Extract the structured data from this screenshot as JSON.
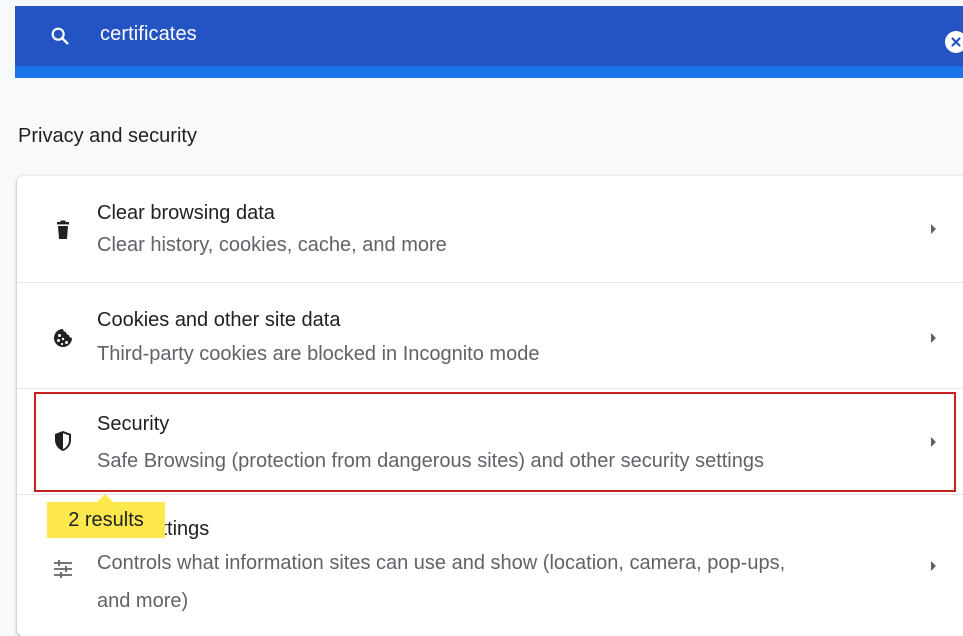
{
  "search": {
    "query": "certificates",
    "icon": "search-icon",
    "clear_icon": "close-icon"
  },
  "section": {
    "title": "Privacy and security"
  },
  "rows": [
    {
      "icon": "trash-icon",
      "title": "Clear browsing data",
      "subtitle": "Clear history, cookies, cache, and more"
    },
    {
      "icon": "cookie-icon",
      "title": "Cookies and other site data",
      "subtitle": "Third-party cookies are blocked in Incognito mode"
    },
    {
      "icon": "shield-icon",
      "title": "Security",
      "subtitle": "Safe Browsing (protection from dangerous sites) and other security settings"
    },
    {
      "icon": "sliders-icon",
      "title": "Site Settings",
      "subtitle_line1": "Controls what information sites can use and show (location, camera, pop-ups,",
      "subtitle_line2": "and more)"
    }
  ],
  "results_badge": "2 results",
  "colors": {
    "header_blue": "#2453c4",
    "highlight_red": "#c5221f",
    "badge_yellow": "#fde84d"
  }
}
